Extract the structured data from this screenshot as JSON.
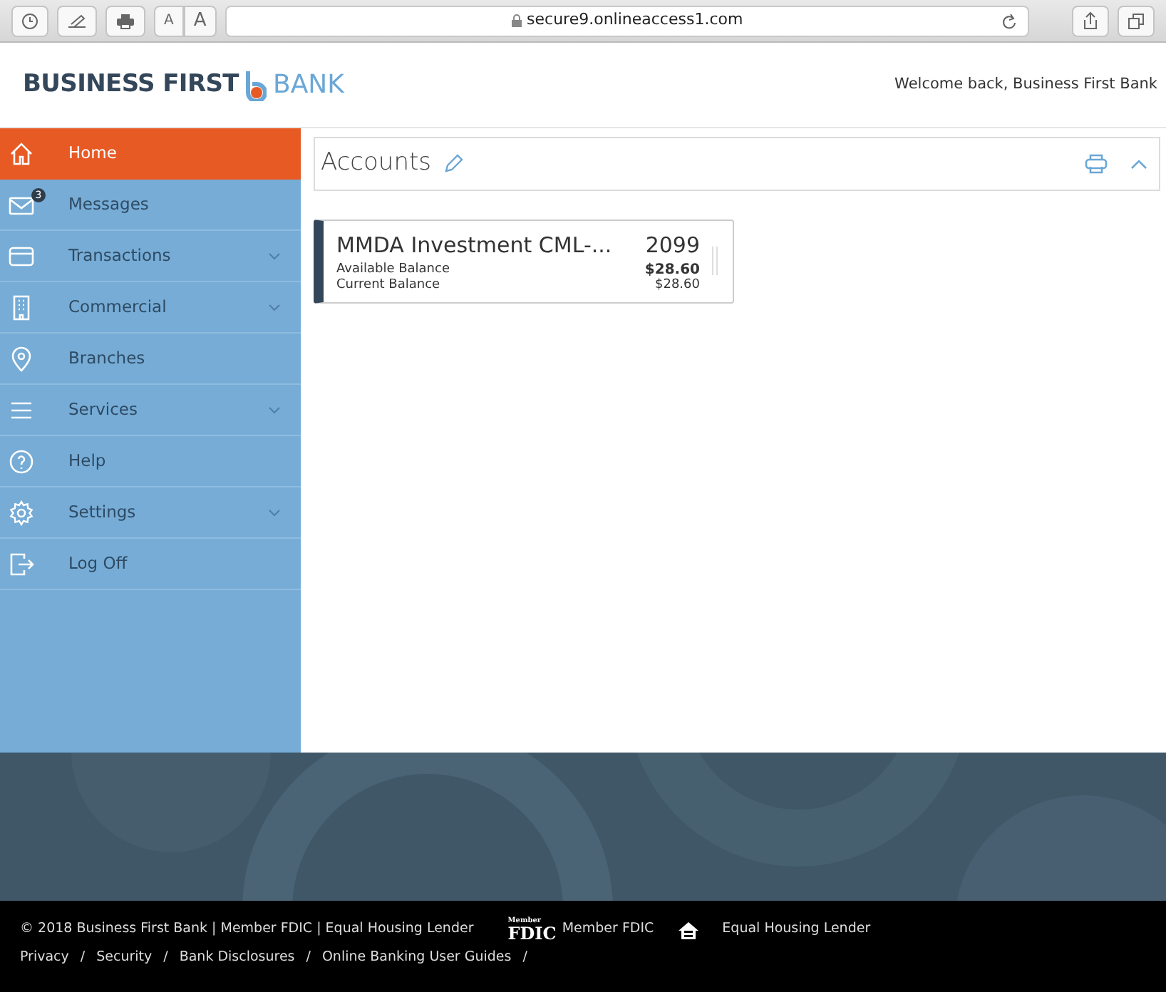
{
  "browser": {
    "text_size_small": "A",
    "text_size_large": "A",
    "url": "secure9.onlineaccess1.com"
  },
  "header": {
    "logo": {
      "bold": "BUSINESS FIRST",
      "light": "BANK"
    },
    "welcome": "Welcome back, Business First Bank"
  },
  "sidebar": {
    "items": [
      {
        "kind": "home",
        "label": "Home",
        "selected": true,
        "expandable": false
      },
      {
        "kind": "mail",
        "label": "Messages",
        "selected": false,
        "expandable": false,
        "badge": "3"
      },
      {
        "kind": "card",
        "label": "Transactions",
        "selected": false,
        "expandable": true
      },
      {
        "kind": "building",
        "label": "Commercial",
        "selected": false,
        "expandable": true
      },
      {
        "kind": "pin",
        "label": "Branches",
        "selected": false,
        "expandable": false
      },
      {
        "kind": "menu",
        "label": "Services",
        "selected": false,
        "expandable": true
      },
      {
        "kind": "help",
        "label": "Help",
        "selected": false,
        "expandable": false
      },
      {
        "kind": "gear",
        "label": "Settings",
        "selected": false,
        "expandable": true
      },
      {
        "kind": "logout",
        "label": "Log Off",
        "selected": false,
        "expandable": false
      }
    ]
  },
  "accounts": {
    "title": "Accounts",
    "expanded": true,
    "cards": [
      {
        "name": "MMDA Investment CML-...",
        "number": "2099",
        "rows": [
          {
            "label": "Available Balance",
            "value": "$28.60",
            "bold": true
          },
          {
            "label": "Current Balance",
            "value": "$28.60",
            "bold": false
          }
        ]
      }
    ]
  },
  "footer": {
    "copyright": "© 2018 Business First Bank | Member FDIC | Equal Housing Lender",
    "fdic_logo": {
      "top": "Member",
      "main": "FDIC"
    },
    "fdic_label": "Member FDIC",
    "housing_label": "Equal Housing Lender",
    "links": [
      {
        "label": "Privacy",
        "separator": "/"
      },
      {
        "label": "Security",
        "separator": "/"
      },
      {
        "label": "Bank Disclosures",
        "separator": "/"
      },
      {
        "label": "Online Banking User Guides",
        "separator": "/"
      }
    ]
  }
}
